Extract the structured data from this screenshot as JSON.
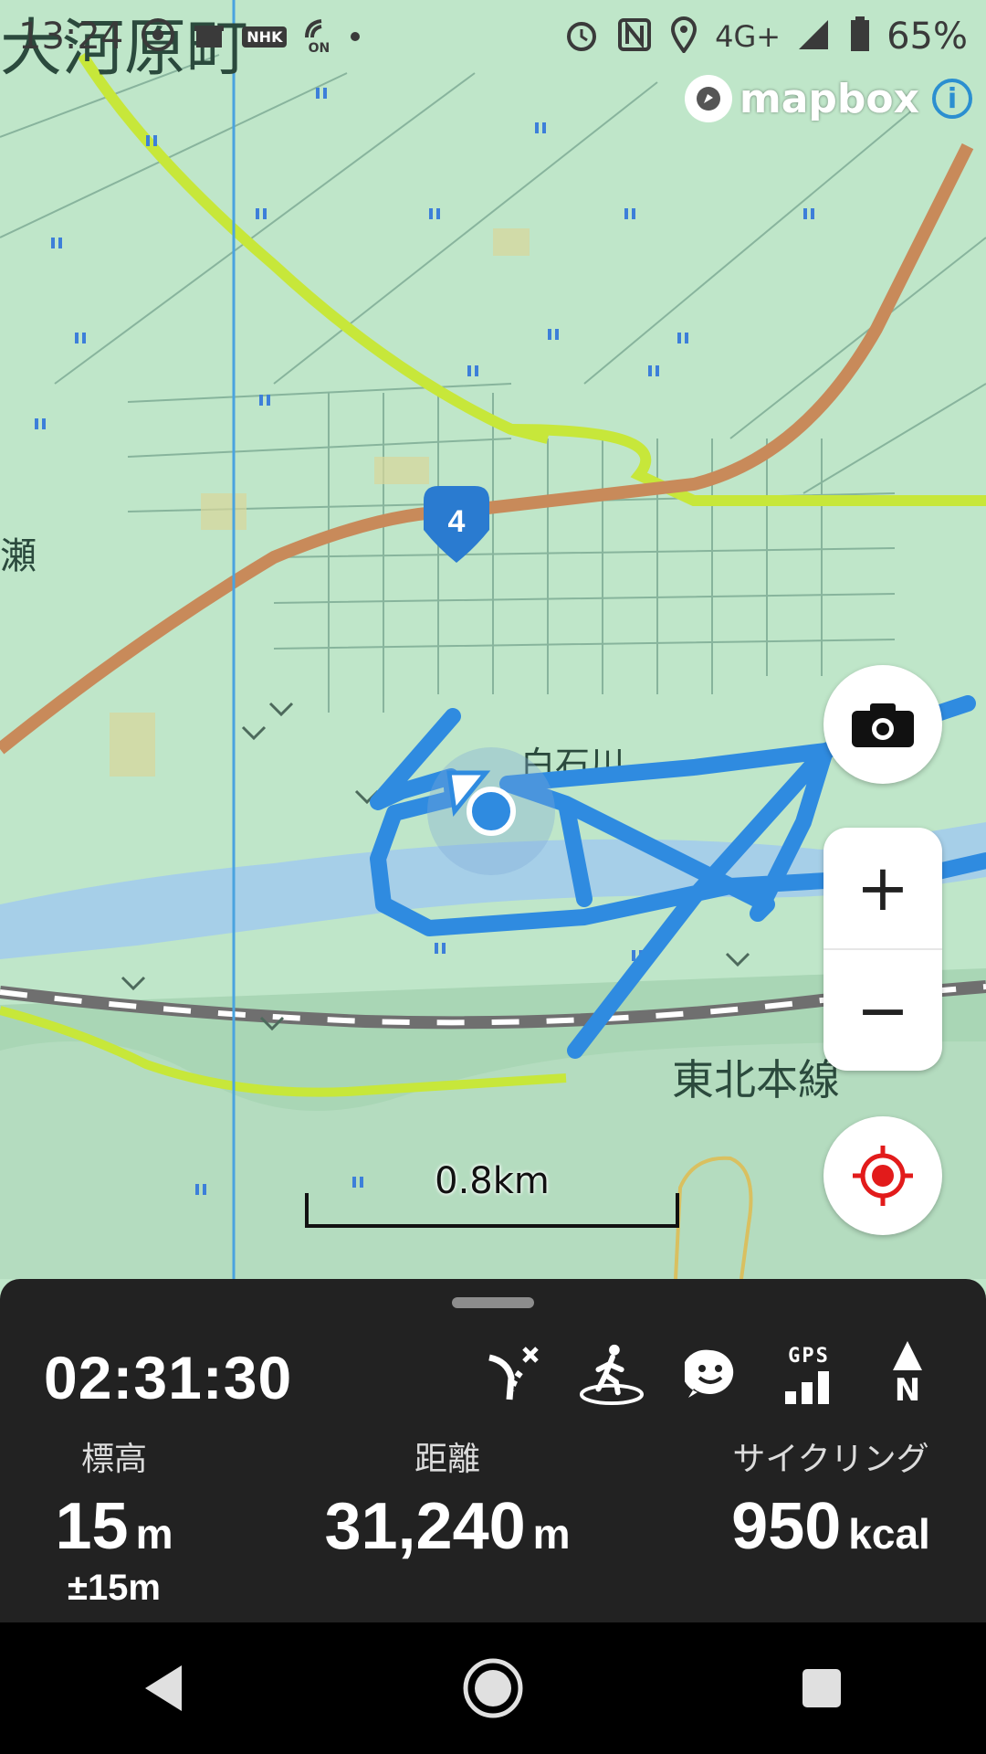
{
  "status_bar": {
    "time": "13:24",
    "network": "4G+",
    "battery": "65%",
    "nhk_label": "NHK",
    "on_label": "ON"
  },
  "map": {
    "place_labels": [
      "大河原町",
      "瀬",
      "白石川",
      "東北本線"
    ],
    "route_badge": "4",
    "attribution": "mapbox",
    "scale_label": "0.8km",
    "colors": {
      "track": "#2f8be0",
      "highway": "#c88a5a",
      "secondary_road": "#c7e73a",
      "river": "#a6cfe8",
      "map_bg": "#bfe6c9"
    }
  },
  "controls": {
    "camera_icon": "camera-icon",
    "zoom_in": "+",
    "zoom_out": "−",
    "locate_icon": "locate-icon"
  },
  "panel": {
    "timer": "02:31:30",
    "gps_label": "GPS",
    "compass_label": "N",
    "elevation": {
      "label": "標高",
      "value": "15",
      "unit": "m",
      "accuracy": "±15m"
    },
    "distance": {
      "label": "距離",
      "value": "31,240",
      "unit": "m"
    },
    "calories": {
      "label": "サイクリング",
      "value": "950",
      "unit": "kcal"
    }
  },
  "nav_bar": {
    "back": "back-icon",
    "home": "home-icon",
    "recents": "recents-icon"
  }
}
